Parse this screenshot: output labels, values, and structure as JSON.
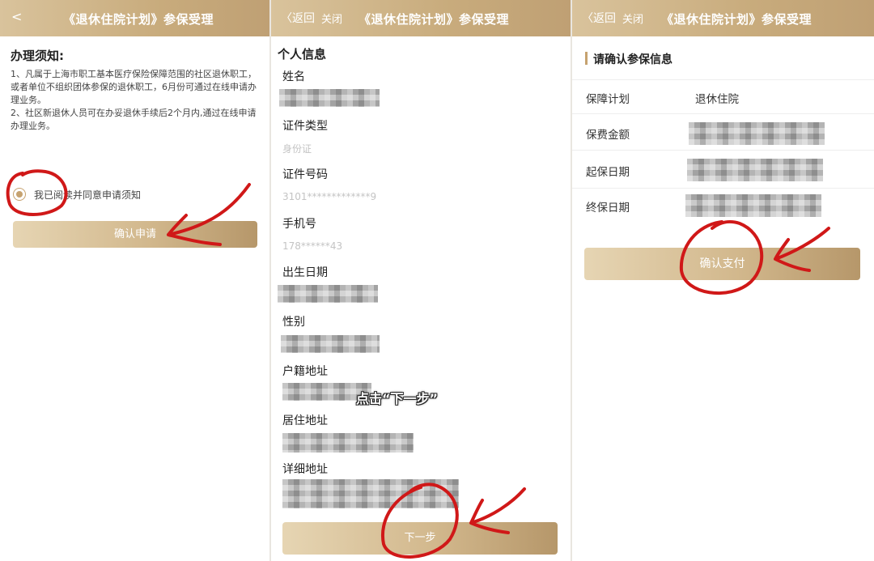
{
  "panel1": {
    "header": {
      "back": "<",
      "title": "《退休住院计划》参保受理"
    },
    "notice_title": "办理须知:",
    "notice_item1": "1、凡属于上海市职工基本医疗保险保障范围的社区退休职工，或者单位不组织团体参保的退休职工，6月份可通过在线申请办理业务。",
    "notice_item2": "2、社区新退休人员可在办妥退休手续后2个月内,通过在线申请办理业务。",
    "agree_label": "我已阅读并同意申请须知",
    "confirm_button": "确认申请"
  },
  "panel2": {
    "header": {
      "back": "〈返回",
      "close": "关闭",
      "title": "《退休住院计划》参保受理"
    },
    "section_title": "个人信息",
    "fields": {
      "name": "姓名",
      "id_type": "证件类型",
      "id_type_value": "身份证",
      "id_number": "证件号码",
      "id_number_value": "3101*************9",
      "phone": "手机号",
      "phone_value": "178******43",
      "birth_date": "出生日期",
      "gender": "性别",
      "household_address": "户籍地址",
      "residence_address": "居住地址",
      "detail_address": "详细地址"
    },
    "caption": "点击“下一步”",
    "next_button": "下一步"
  },
  "panel3": {
    "header": {
      "back": "〈返回",
      "close": "关闭",
      "title": "《退休住院计划》参保受理"
    },
    "section_title": "请确认参保信息",
    "rows": {
      "plan_label": "保障计划",
      "plan_value": "退休住院",
      "premium_label": "保费金额",
      "start_label": "起保日期",
      "end_label": "终保日期"
    },
    "pay_button": "确认支付"
  },
  "colors": {
    "header_gold": "#c8ab7c",
    "button_gold": "#d2b88d",
    "annotation_red": "#d01818",
    "radio_gold": "#c6a26f"
  }
}
